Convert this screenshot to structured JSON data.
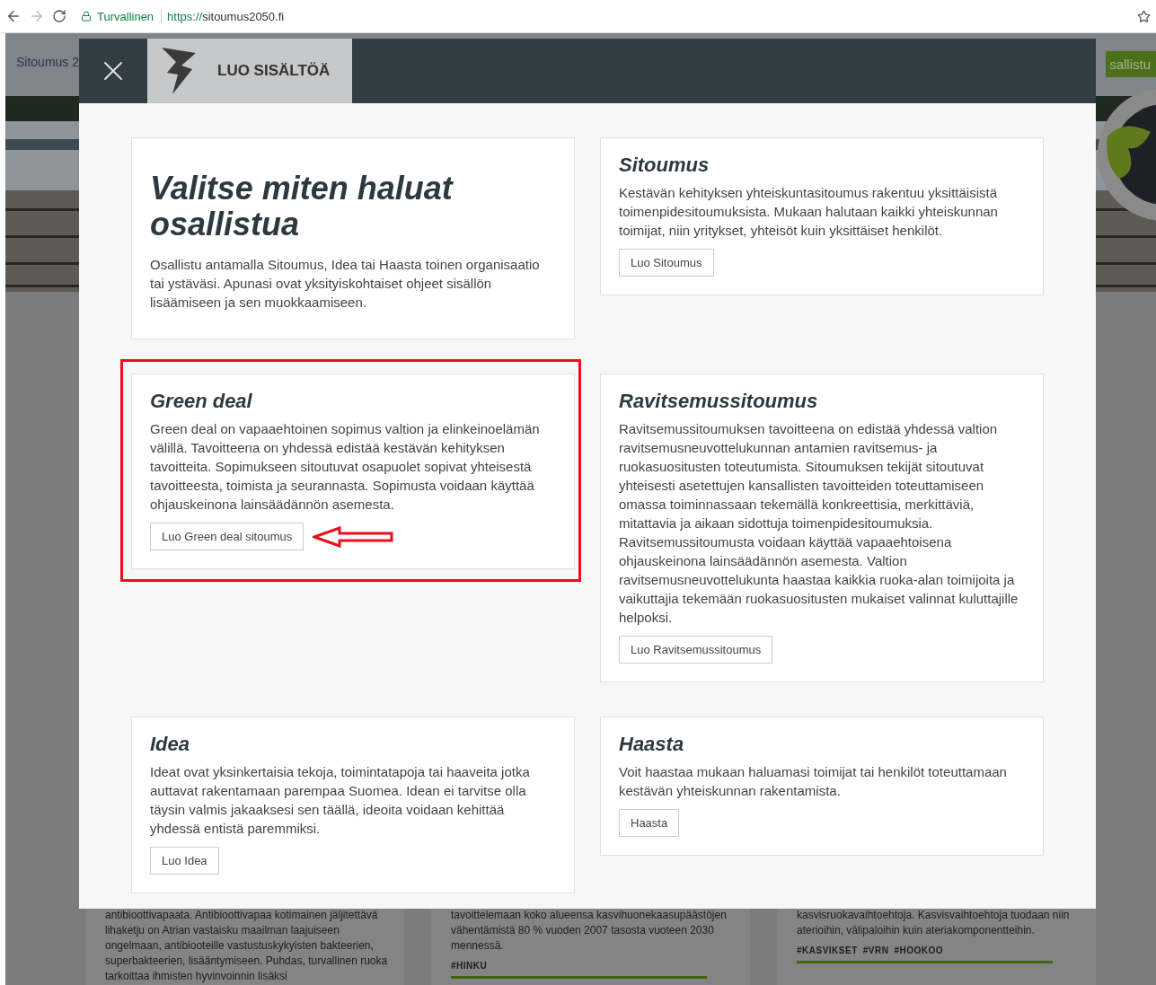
{
  "browser": {
    "security_label": "Turvallinen",
    "url_scheme": "https://",
    "url_host": "sitoumus2050.fi"
  },
  "background": {
    "nav_text": "Sitoumus 2",
    "join_button": "sallistu",
    "cards": [
      {
        "text": "antibioottivapaata. Antibioottivapaa kotimainen jäljitettävä lihaketju on Atrian vastaisku maailman laajuiseen ongelmaan, antibiooteille vastustuskykyisten bakteerien, superbakteerien, lisääntymiseen. Puhdas, turvallinen ruoka tarkoittaa ihmisten hyvinvoinnin lisäksi"
      },
      {
        "text": "tavoittelemaan koko alueensa kasvihuonekaasupäästöjen vähentämistä 80 % vuoden 2007 tasosta vuoteen 2030 mennessä.",
        "tags": [
          "#HINKU"
        ]
      },
      {
        "text": "kasvisruokavaihtoehtoja. Kasvisvaihtoehtoja tuodaan niin aterioihin, välipaloihin kuin ateriakomponentteihin.",
        "tags": [
          "#KASVIKSET",
          "#VRN",
          "#HOOKOO"
        ]
      }
    ]
  },
  "modal": {
    "tab_label": "LUO SISÄLTÖÄ",
    "intro": {
      "title": "Valitse miten haluat osallistua",
      "text": "Osallistu antamalla Sitoumus, Idea tai Haasta toinen organisaatio tai ystäväsi. Apunasi ovat yksityiskohtaiset ohjeet sisällön lisäämiseen ja sen muokkaamiseen."
    },
    "cards": [
      {
        "kind": "option",
        "title": "Sitoumus",
        "text": "Kestävän kehityksen yhteiskuntasitoumus rakentuu yksittäisistä toimenpidesitoumuksista. Mukaan halutaan kaikki yhteiskunnan toimijat, niin yritykset, yhteisöt kuin yksittäiset henkilöt.",
        "button": "Luo Sitoumus",
        "highlighted": false
      },
      {
        "kind": "option",
        "title": "Green deal",
        "text": "Green deal on vapaaehtoinen sopimus valtion ja elinkeinoelämän välillä. Tavoitteena on yhdessä edistää kestävän kehityksen tavoitteita. Sopimukseen sitoutuvat osapuolet sopivat yhteisestä tavoitteesta, toimista ja seurannasta. Sopimusta voidaan käyttää ohjauskeinona lainsäädännön asemesta.",
        "button": "Luo Green deal sitoumus",
        "highlighted": true
      },
      {
        "kind": "option",
        "title": "Ravitsemussitoumus",
        "text": "Ravitsemussitoumuksen tavoitteena on edistää yhdessä valtion ravitsemusneuvottelukunnan antamien ravitsemus- ja ruokasuositusten toteutumista. Sitoumuksen tekijät sitoutuvat yhteisesti asetettujen kansallisten tavoitteiden toteuttamiseen omassa toiminnassaan tekemällä konkreettisia, merkittäviä, mitattavia ja aikaan sidottuja toimenpidesitoumuksia. Ravitsemussitoumusta voidaan käyttää vapaaehtoisena ohjauskeinona lainsäädännön asemesta. Valtion ravitsemusneuvottelukunta haastaa kaikkia ruoka-alan toimijoita ja vaikuttajia tekemään ruokasuositusten mukaiset valinnat kuluttajille helpoksi.",
        "button": "Luo Ravitsemussitoumus",
        "highlighted": false
      },
      {
        "kind": "option",
        "title": "Idea",
        "text": "Ideat ovat yksinkertaisia tekoja, toimintatapoja tai haaveita jotka auttavat rakentamaan parempaa Suomea. Idean ei tarvitse olla täysin valmis jakaaksesi sen täällä, ideoita voidaan kehittää yhdessä entistä paremmiksi.",
        "button": "Luo Idea",
        "highlighted": false
      },
      {
        "kind": "option",
        "title": "Haasta",
        "text": "Voit haastaa mukaan haluamasi toimijat tai henkilöt toteuttamaan kestävän yhteiskunnan rakentamista.",
        "button": "Haasta",
        "highlighted": false
      }
    ]
  }
}
